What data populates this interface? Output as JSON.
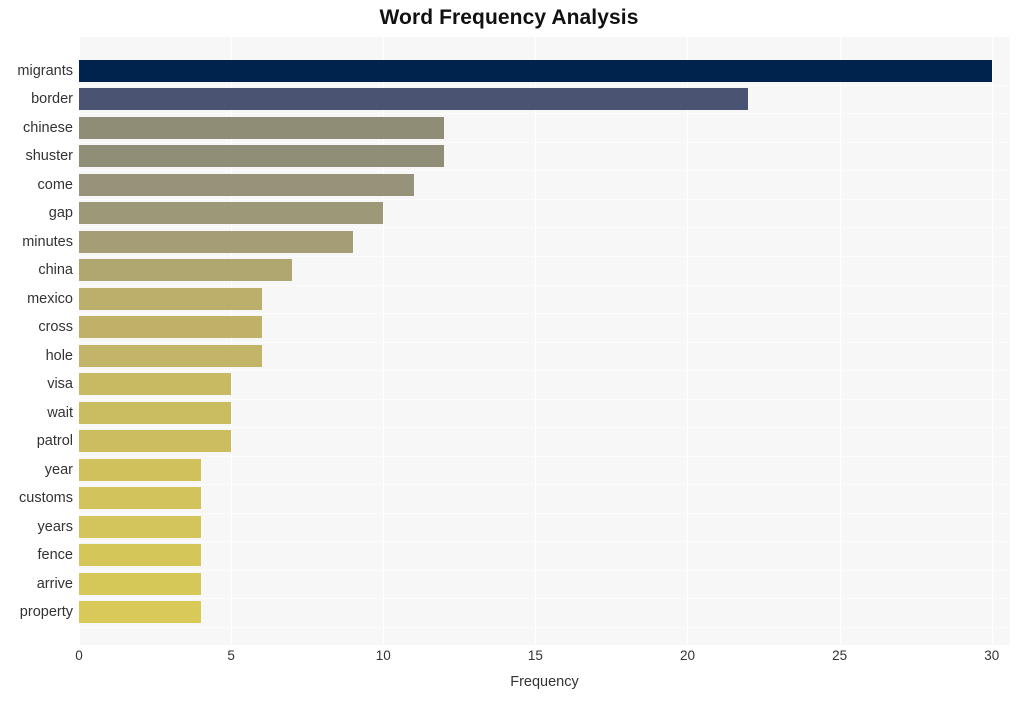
{
  "chart_data": {
    "type": "bar",
    "orientation": "horizontal",
    "title": "Word Frequency Analysis",
    "xlabel": "Frequency",
    "ylabel": "",
    "xlim": [
      0,
      30.6
    ],
    "xticks": [
      0,
      5,
      10,
      15,
      20,
      25,
      30
    ],
    "xtick_labels": [
      "0",
      "5",
      "10",
      "15",
      "20",
      "25",
      "30"
    ],
    "grid": true,
    "legend": null,
    "categories": [
      "migrants",
      "border",
      "chinese",
      "shuster",
      "come",
      "gap",
      "minutes",
      "china",
      "mexico",
      "cross",
      "hole",
      "visa",
      "wait",
      "patrol",
      "year",
      "customs",
      "years",
      "fence",
      "arrive",
      "property"
    ],
    "values": [
      30,
      22,
      12,
      12,
      11,
      10,
      9,
      7,
      6,
      6,
      6,
      5,
      5,
      5,
      4,
      4,
      4,
      4,
      4,
      4
    ],
    "bar_colors": [
      "#00234e",
      "#4b5372",
      "#8f8d76",
      "#908e77",
      "#97937a",
      "#9d9878",
      "#a49d76",
      "#b0a66f",
      "#bbaf6b",
      "#bfb268",
      "#c2b567",
      "#c8ba63",
      "#cabc61",
      "#ccbe60",
      "#d0c15d",
      "#d2c35c",
      "#d3c45b",
      "#d5c65a",
      "#d6c759",
      "#d8c958"
    ],
    "plot_background": "#f7f7f7",
    "gridline_color": "#ffffff",
    "text_color": "#333333",
    "title_color": "#111111"
  },
  "axis": {
    "x_label": "Frequency"
  }
}
